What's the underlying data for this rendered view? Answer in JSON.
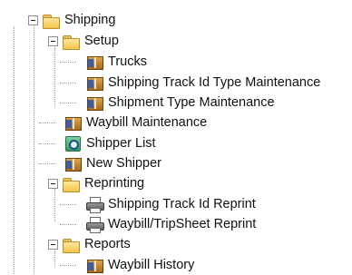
{
  "tree": {
    "shipping": {
      "label": "Shipping",
      "icon": "folder-open-icon",
      "setup": {
        "label": "Setup",
        "icon": "folder-open-icon",
        "items": [
          {
            "label": "Trucks",
            "icon": "package-icon"
          },
          {
            "label": "Shipping Track Id Type Maintenance",
            "icon": "package-icon"
          },
          {
            "label": "Shipment Type Maintenance",
            "icon": "package-icon"
          }
        ]
      },
      "waybill_maintenance": {
        "label": "Waybill Maintenance",
        "icon": "package-icon"
      },
      "shipper_list": {
        "label": "Shipper List",
        "icon": "list-search-icon"
      },
      "new_shipper": {
        "label": "New Shipper",
        "icon": "package-icon"
      },
      "reprinting": {
        "label": "Reprinting",
        "icon": "folder-open-icon",
        "items": [
          {
            "label": "Shipping Track Id Reprint",
            "icon": "printer-icon"
          },
          {
            "label": "Waybill/TripSheet Reprint",
            "icon": "printer-icon"
          }
        ]
      },
      "reports": {
        "label": "Reports",
        "icon": "folder-open-icon",
        "items": [
          {
            "label": "Waybill History",
            "icon": "package-icon"
          }
        ]
      }
    }
  }
}
